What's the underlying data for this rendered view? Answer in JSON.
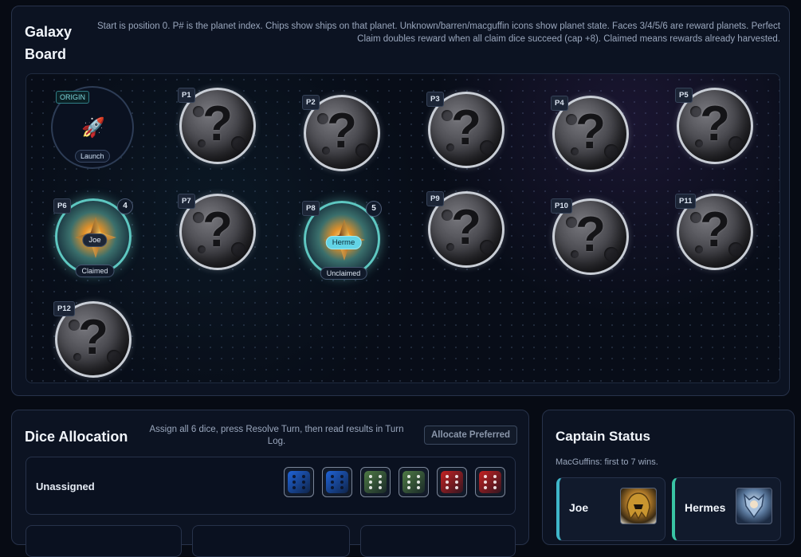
{
  "board": {
    "title": "Galaxy Board",
    "help": "Start is position 0. P# is the planet index. Chips show ships on that planet. Unknown/barren/macguffin icons show planet state. Faces 3/4/5/6 are reward planets. Perfect Claim doubles reward when all claim dice succeed (cap +8). Claimed means rewards already harvested.",
    "origin": {
      "tag": "ORIGIN",
      "icon": "rocket-icon",
      "chip": "Launch",
      "glyph": "🚀"
    },
    "unknown_glyph": "?",
    "planets": [
      {
        "label": "P1",
        "state": "unknown"
      },
      {
        "label": "P2",
        "state": "unknown"
      },
      {
        "label": "P3",
        "state": "unknown"
      },
      {
        "label": "P4",
        "state": "unknown"
      },
      {
        "label": "P5",
        "state": "unknown"
      },
      {
        "label": "P6",
        "state": "reward",
        "face": "4",
        "ship": "Joe",
        "status": "Claimed"
      },
      {
        "label": "P7",
        "state": "unknown"
      },
      {
        "label": "P8",
        "state": "reward",
        "face": "5",
        "ship": "Herme",
        "status": "Unclaimed"
      },
      {
        "label": "P9",
        "state": "unknown"
      },
      {
        "label": "P10",
        "state": "unknown"
      },
      {
        "label": "P11",
        "state": "unknown"
      },
      {
        "label": "P12",
        "state": "unknown"
      }
    ]
  },
  "dice": {
    "title": "Dice Allocation",
    "help": "Assign all 6 dice, press Resolve Turn, then read results in Turn Log.",
    "allocate_label": "Allocate Preferred",
    "unassigned_label": "Unassigned",
    "unassigned": [
      {
        "color": "blue",
        "hex": "#1f63d8",
        "face": 6
      },
      {
        "color": "blue",
        "hex": "#1f63d8",
        "face": 6
      },
      {
        "color": "green",
        "hex": "#4e7a44",
        "face": 6
      },
      {
        "color": "green",
        "hex": "#4e7a44",
        "face": 6
      },
      {
        "color": "red",
        "hex": "#c42222",
        "face": 6
      },
      {
        "color": "red",
        "hex": "#c42222",
        "face": 6
      }
    ]
  },
  "captain": {
    "title": "Captain Status",
    "subtitle": "MacGuffins: first to 7 wins.",
    "captains": [
      {
        "name": "Joe",
        "avatar": "golden-helmet-avatar"
      },
      {
        "name": "Hermes",
        "avatar": "hermes-armored-avatar"
      }
    ]
  },
  "colors": {
    "accent": "#63d4e6",
    "panel": "#0c1322",
    "border": "#27324a"
  }
}
